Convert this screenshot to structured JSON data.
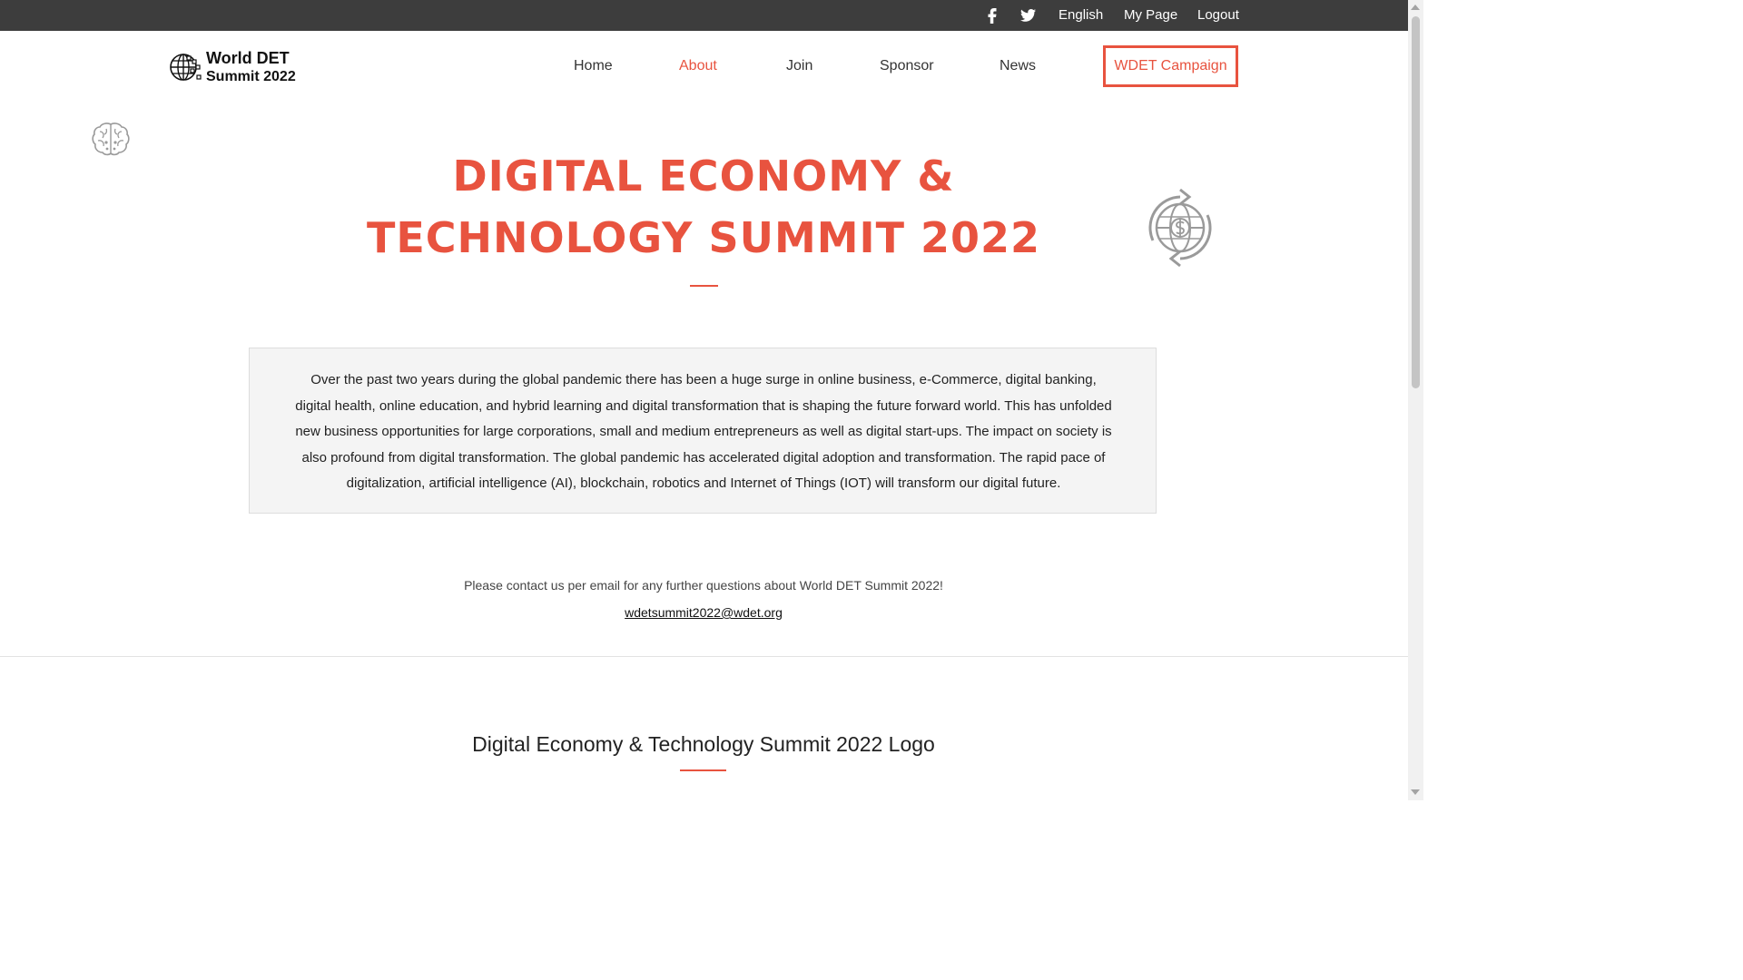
{
  "topbar": {
    "facebook_icon": "facebook-icon",
    "twitter_icon": "twitter-icon",
    "language": "English",
    "my_page": "My Page",
    "logout": "Logout"
  },
  "header": {
    "logo_line1": "World DET",
    "logo_line2": "Summit 2022",
    "nav": {
      "home": "Home",
      "about": "About",
      "join": "Join",
      "sponsor": "Sponsor",
      "news": "News",
      "campaign": "WDET Campaign"
    },
    "active_item": "About"
  },
  "hero": {
    "title_line1": "DIGITAL ECONOMY &",
    "title_line2": "TECHNOLOGY SUMMIT 2022",
    "left_deco_icon": "brain-icon",
    "right_deco_icon": "globe-dollar-icon"
  },
  "intro": {
    "text": "Over the past two years during the global pandemic there has been a huge surge in online business, e-Commerce, digital banking, digital health, online education, and hybrid learning and digital transformation that is shaping the future forward world. This has unfolded new business opportunities for large corporations, small and medium entrepreneurs as well as digital start-ups. The impact on society is also profound from digital transformation. The global pandemic has accelerated digital adoption and transformation. The rapid pace of digitalization, artificial intelligence (AI), blockchain, robotics and Internet of Things (IOT) will transform our digital future."
  },
  "contact": {
    "text": "Please contact us per email for any further questions about World DET Summit 2022!",
    "email": "wdetsummit2022@wdet.org"
  },
  "logo_section": {
    "title": "Digital Economy & Technology Summit 2022 Logo"
  },
  "colors": {
    "accent": "#e8533f",
    "topbar_bg": "#3d3d3d",
    "intro_bg": "#f4f4f4",
    "deco": "#9a9a9a"
  }
}
